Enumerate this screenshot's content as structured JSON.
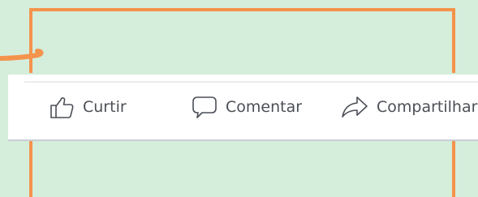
{
  "actions": {
    "like": {
      "label": "Curtir",
      "icon": "thumbs-up-icon"
    },
    "comment": {
      "label": "Comentar",
      "icon": "speech-bubble-icon"
    },
    "share": {
      "label": "Compartilhar",
      "icon": "share-arrow-icon"
    }
  },
  "colors": {
    "background": "#d5eddb",
    "frame_accent": "#f4934c",
    "bar_background": "#ffffff",
    "label_text": "#4b4f56"
  }
}
